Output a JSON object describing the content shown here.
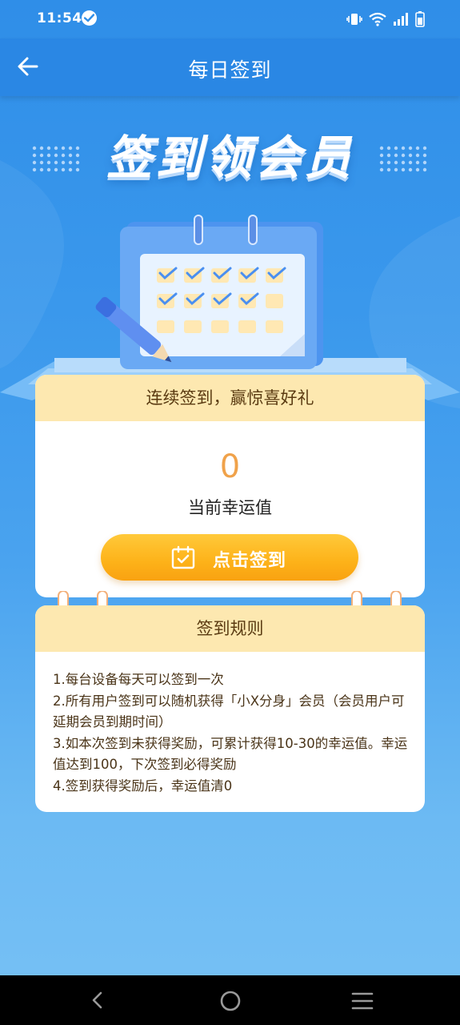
{
  "status_bar": {
    "time": "11:54",
    "icons": [
      "check-circle-icon",
      "vibrate-icon",
      "wifi-icon",
      "signal-icon",
      "battery-icon"
    ]
  },
  "app_bar": {
    "title": "每日签到",
    "back_icon": "arrow-left-icon"
  },
  "banner": {
    "title": "签到领会员",
    "illustration": "calendar-with-pencil"
  },
  "checkin_card": {
    "header": "连续签到，赢惊喜好礼",
    "luck_value": "0",
    "luck_label": "当前幸运值",
    "button_label": "点击签到",
    "button_icon": "calendar-check-icon"
  },
  "rules_card": {
    "header": "签到规则",
    "lines": [
      "1.每台设备每天可以签到一次",
      "2.所有用户签到可以随机获得「小X分身」会员（会员用户可延期会员到期时间）",
      "3.如本次签到未获得奖励，可累计获得10-30的幸运值。幸运值达到100，下次签到必得奖励",
      "4.签到获得奖励后，幸运值清0"
    ]
  },
  "nav_bar": {
    "icons": [
      "nav-back-icon",
      "nav-home-icon",
      "nav-menu-icon"
    ]
  },
  "colors": {
    "primary_blue": "#2a87e4",
    "card_header": "#fde8b0",
    "button_orange": "#fdb219",
    "luck_value": "#f0a24a"
  }
}
